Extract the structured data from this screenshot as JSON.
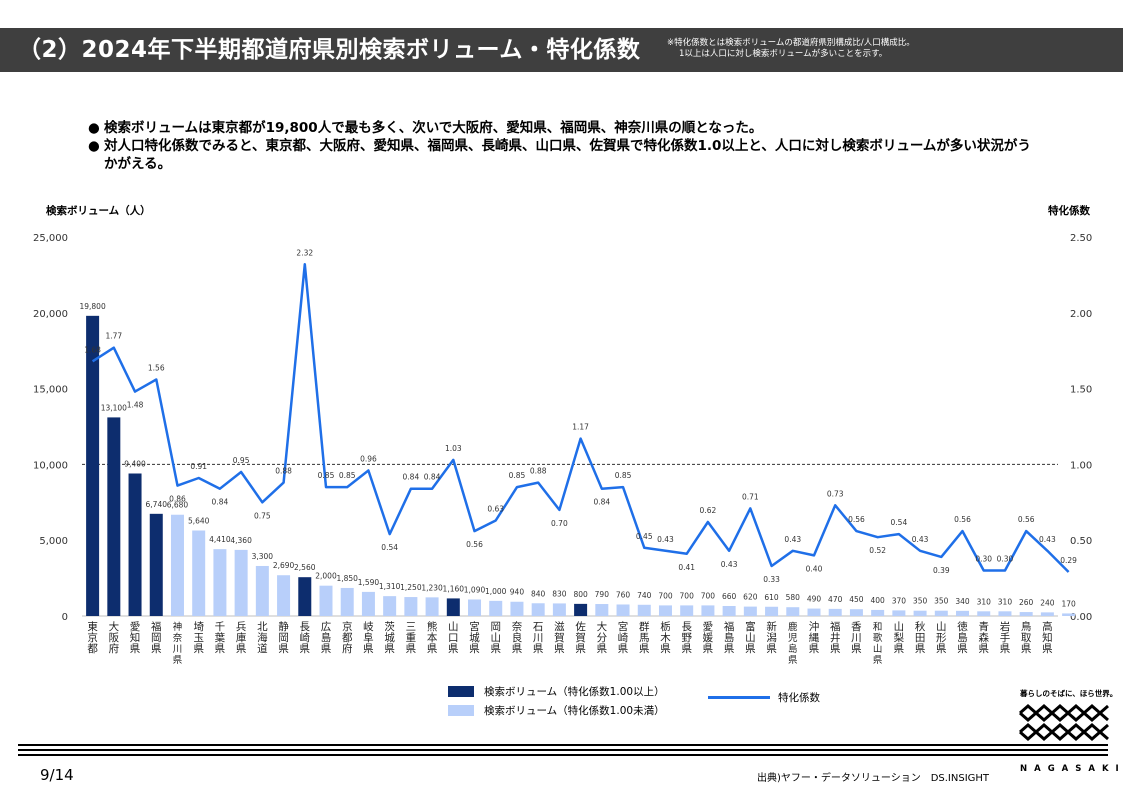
{
  "header": {
    "title": "（2）2024年下半期都道府県別検索ボリューム・特化係数",
    "note_line1": "※特化係数とは検索ボリュームの都道府県別構成比/人口構成比。",
    "note_line2": "1以上は人口に対し検索ボリュームが多いことを示す。"
  },
  "bullets": [
    "検索ボリュームは東京都が19,800人で最も多く、次いで大阪府、愛知県、福岡県、神奈川県の順となった。",
    "対人口特化係数でみると、東京都、大阪府、愛知県、福岡県、長崎県、山口県、佐賀県で特化係数1.0以上と、人口に対し検索ボリュームが多い状況がうかがえる。"
  ],
  "bullet_marker": "●",
  "chart_data": {
    "type": "bar",
    "left_axis_title": "検索ボリューム（人）",
    "right_axis_title": "特化係数",
    "left_ticks": [
      "0",
      "5,000",
      "10,000",
      "15,000",
      "20,000",
      "25,000"
    ],
    "right_ticks": [
      "0.00",
      "0.50",
      "1.00",
      "1.50",
      "2.00",
      "2.50"
    ],
    "ylim_left": [
      0,
      25000
    ],
    "ylim_right": [
      0,
      2.5
    ],
    "reference_line": 1.0,
    "categories": [
      "東京都",
      "大阪府",
      "愛知県",
      "福岡県",
      "神奈川県",
      "埼玉県",
      "千葉県",
      "兵庫県",
      "北海道",
      "静岡県",
      "長崎県",
      "広島県",
      "京都府",
      "岐阜県",
      "茨城県",
      "三重県",
      "熊本県",
      "山口県",
      "宮城県",
      "岡山県",
      "奈良県",
      "石川県",
      "滋賀県",
      "佐賀県",
      "大分県",
      "宮崎県",
      "群馬県",
      "栃木県",
      "長野県",
      "愛媛県",
      "福島県",
      "富山県",
      "新潟県",
      "鹿児島県",
      "沖縄県",
      "福井県",
      "香川県",
      "和歌山県",
      "山梨県",
      "秋田県",
      "山形県",
      "徳島県",
      "青森県",
      "岩手県",
      "鳥取県",
      "高知県"
    ],
    "bar_values": [
      19800,
      13100,
      9400,
      6740,
      6680,
      5640,
      4410,
      4360,
      3300,
      2690,
      2560,
      2000,
      1850,
      1590,
      1310,
      1250,
      1230,
      1160,
      1090,
      1000,
      940,
      840,
      830,
      800,
      790,
      760,
      740,
      700,
      700,
      700,
      660,
      620,
      610,
      580,
      490,
      470,
      450,
      400,
      370,
      350,
      350,
      340,
      310,
      310,
      260,
      240,
      170
    ],
    "bar_labels": [
      "19,800",
      "13,100",
      "9,400",
      "6,740",
      "6,680",
      "5,640",
      "4,410",
      "4,360",
      "3,300",
      "2,690",
      "2,560",
      "2,000",
      "1,850",
      "1,590",
      "1,310",
      "1,250",
      "1,230",
      "1,160",
      "1,090",
      "1,000",
      "940",
      "840",
      "830",
      "800",
      "790",
      "760",
      "740",
      "700",
      "700",
      "700",
      "660",
      "620",
      "610",
      "580",
      "490",
      "470",
      "450",
      "400",
      "370",
      "350",
      "350",
      "340",
      "310",
      "310",
      "260",
      "240",
      "170"
    ],
    "coefficient_values": [
      1.68,
      1.77,
      1.48,
      1.56,
      0.86,
      0.91,
      0.84,
      0.95,
      0.75,
      0.88,
      2.32,
      0.85,
      0.85,
      0.96,
      0.54,
      0.84,
      0.84,
      1.03,
      0.56,
      0.63,
      0.85,
      0.88,
      0.7,
      1.17,
      0.84,
      0.85,
      0.45,
      0.43,
      0.41,
      0.62,
      0.43,
      0.71,
      0.33,
      0.43,
      0.4,
      0.73,
      0.56,
      0.52,
      0.54,
      0.43,
      0.39,
      0.56,
      0.3,
      0.3,
      0.56,
      0.43,
      0.29
    ],
    "coefficient_labels": [
      "1.68",
      "1.77",
      "1.48",
      "1.56",
      "0.86",
      "0.91",
      "0.84",
      "0.95",
      "0.75",
      "0.88",
      "2.32",
      "0.85",
      "0.85",
      "0.96",
      "0.54",
      "0.84",
      "0.84",
      "1.03",
      "0.56",
      "0.63",
      "0.85",
      "0.88",
      "0.70",
      "1.17",
      "0.84",
      "0.85",
      "0.45",
      "0.43",
      "0.41",
      "0.62",
      "0.43",
      "0.71",
      "0.33",
      "0.43",
      "0.40",
      "0.73",
      "0.56",
      "0.52",
      "0.54",
      "0.43",
      "0.39",
      "0.56",
      "0.30",
      "0.30",
      "0.56",
      "0.43",
      "0.29"
    ],
    "series": [
      {
        "name": "検索ボリューム（特化係数1.00以上）",
        "color": "#0d2d6e"
      },
      {
        "name": "検索ボリューム（特化係数1.00未満）",
        "color": "#b8cffa"
      },
      {
        "name": "特化係数",
        "color": "#1f6fe8"
      }
    ]
  },
  "footer": {
    "page": "9/14",
    "source": "出典)ヤフー・データソリューション　DS.INSIGHT",
    "logo_tagline": "暮らしのそばに、ほら世界。",
    "logo_word": "NAGASAKI"
  }
}
